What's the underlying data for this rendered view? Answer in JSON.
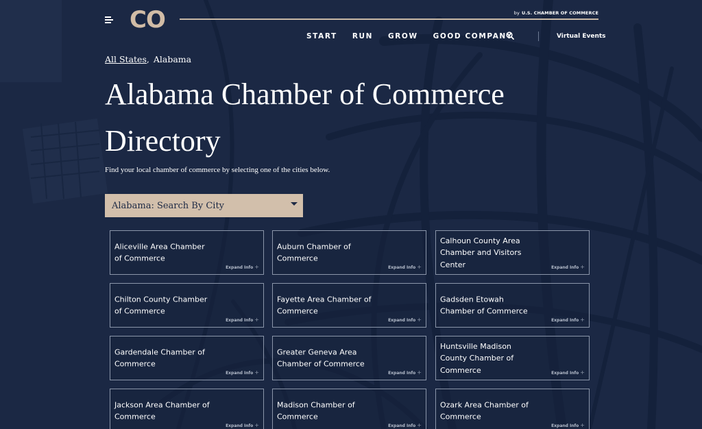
{
  "header": {
    "logo_text": "CO",
    "by_prefix": "by",
    "by_brand": "U.S. CHAMBER OF COMMERCE",
    "nav": [
      "START",
      "RUN",
      "GROW",
      "GOOD COMPANY"
    ],
    "virtual_events": "Virtual Events",
    "icons": {
      "menu": "hamburger-icon",
      "search": "search-icon"
    }
  },
  "breadcrumb": {
    "root": "All States",
    "current": "Alabama"
  },
  "page": {
    "title": "Alabama Chamber of Commerce Directory",
    "description": "Find your local chamber of commerce by selecting one of the cities below."
  },
  "dropdown": {
    "label": "Alabama: Search By City"
  },
  "card_action_label": "Expand Info",
  "cards": [
    {
      "name": "Aliceville Area Chamber of Commerce"
    },
    {
      "name": "Auburn Chamber of Commerce"
    },
    {
      "name": "Calhoun County Area Chamber and Visitors Center"
    },
    {
      "name": "Chilton County Chamber of Commerce"
    },
    {
      "name": "Fayette Area Chamber of Commerce"
    },
    {
      "name": "Gadsden Etowah Chamber of Commerce"
    },
    {
      "name": "Gardendale Chamber of Commerce"
    },
    {
      "name": "Greater Geneva Area Chamber of Commerce"
    },
    {
      "name": "Huntsville Madison County Chamber of Commerce"
    },
    {
      "name": "Jackson Area Chamber of Commerce"
    },
    {
      "name": "Madison Chamber of Commerce"
    },
    {
      "name": "Ozark Area Chamber of Commerce"
    }
  ],
  "colors": {
    "background": "#1b2844",
    "accent_tan": "#d1bca6",
    "dropdown_bg": "#d2bfab",
    "card_border": "#8b96aa"
  }
}
